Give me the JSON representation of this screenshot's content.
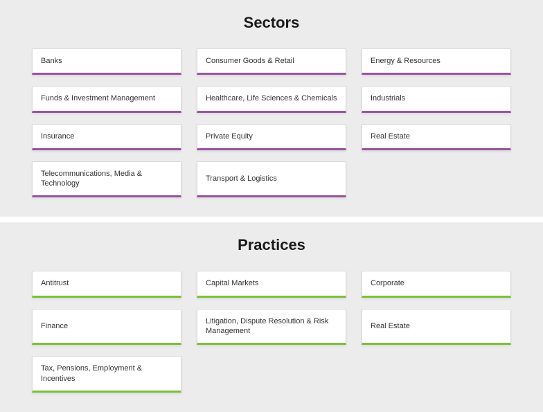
{
  "sections": {
    "sectors": {
      "title": "Sectors",
      "items": [
        "Banks",
        "Consumer Goods & Retail",
        "Energy & Resources",
        "Funds & Investment Management",
        "Healthcare, Life Sciences & Chemicals",
        "Industrials",
        "Insurance",
        "Private Equity",
        "Real Estate",
        "Telecommunications, Media & Technology",
        "Transport & Logistics"
      ]
    },
    "practices": {
      "title": "Practices",
      "items": [
        "Antitrust",
        "Capital Markets",
        "Corporate",
        "Finance",
        "Litigation, Dispute Resolution & Risk Management",
        "Real Estate",
        "Tax, Pensions, Employment & Incentives"
      ]
    }
  },
  "colors": {
    "sectors_accent": "#9b52a1",
    "practices_accent": "#7bbf3a",
    "section_bg": "#ececec"
  }
}
